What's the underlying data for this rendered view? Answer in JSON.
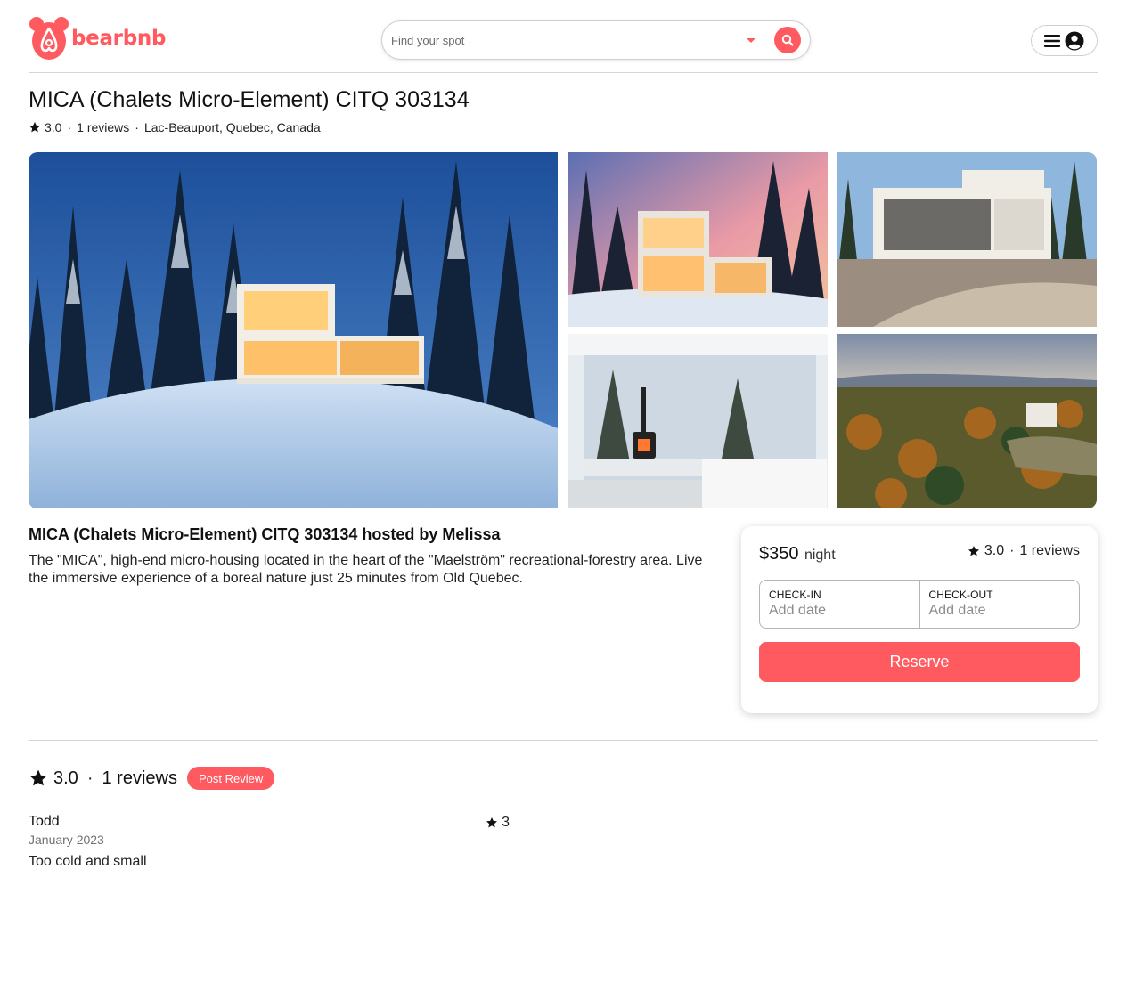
{
  "brand": {
    "name": "bearbnb",
    "color": "#ff5a5f"
  },
  "header": {
    "search": {
      "placeholder": "Find your spot"
    },
    "icons": [
      "bear-logo-icon",
      "chevron-down-icon",
      "search-icon",
      "hamburger-menu-icon",
      "user-profile-icon"
    ]
  },
  "listing": {
    "title": "MICA (Chalets Micro-Element) CITQ 303134",
    "rating": "3.0",
    "reviews_count_label": "1 reviews",
    "location": "Lac-Beauport, Quebec, Canada",
    "host_line": "MICA (Chalets Micro-Element) CITQ 303134 hosted by Melissa",
    "description": "The \"MICA\", high-end micro-housing located in the heart of the \"Maelström\" recreational-forestry area. Live the immersive experience of a boreal nature just 25 minutes from Old Quebec."
  },
  "booking": {
    "price": "$350",
    "price_unit": "night",
    "rating": "3.0",
    "reviews_label": "1 reviews",
    "checkin_label": "CHECK-IN",
    "checkin_value": "Add date",
    "checkout_label": "CHECK-OUT",
    "checkout_value": "Add date",
    "reserve_label": "Reserve"
  },
  "reviews": {
    "rating": "3.0",
    "count_label": "1 reviews",
    "post_label": "Post Review",
    "items": [
      {
        "name": "Todd",
        "date": "January 2023",
        "text": "Too cold and small",
        "stars": "3"
      }
    ]
  }
}
